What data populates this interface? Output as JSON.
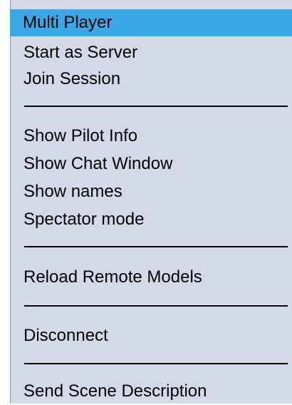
{
  "menu": {
    "header": "Multi Player",
    "items": [
      "Start as Server",
      "Join Session",
      "Show Pilot Info",
      "Show Chat Window",
      "Show names",
      "Spectator mode",
      "Reload Remote Models",
      "Disconnect",
      "Send Scene Description"
    ]
  }
}
